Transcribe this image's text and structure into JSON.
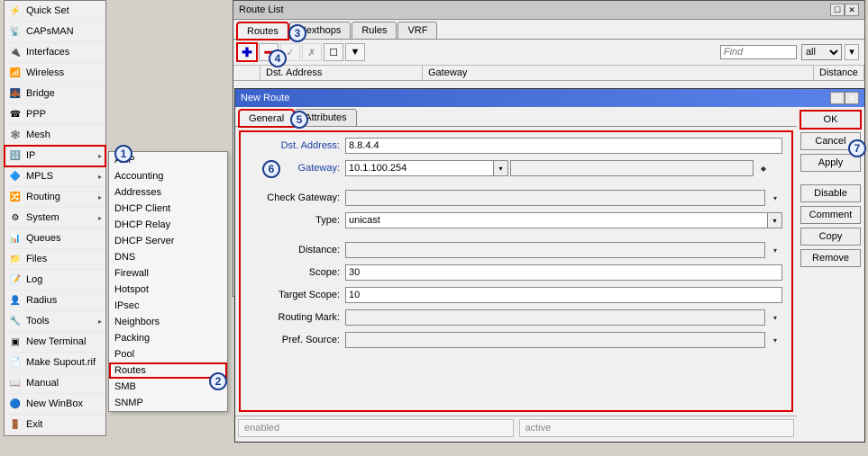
{
  "sidebar": {
    "items": [
      {
        "label": "Quick Set",
        "icon": "⚙"
      },
      {
        "label": "CAPsMAN",
        "icon": "📡"
      },
      {
        "label": "Interfaces",
        "icon": "🔌"
      },
      {
        "label": "Wireless",
        "icon": "📶"
      },
      {
        "label": "Bridge",
        "icon": "🌉"
      },
      {
        "label": "PPP",
        "icon": "☎"
      },
      {
        "label": "Mesh",
        "icon": "🕸"
      },
      {
        "label": "IP",
        "icon": "🔢",
        "arrow": true,
        "highlighted": true
      },
      {
        "label": "MPLS",
        "icon": "🔷",
        "arrow": true
      },
      {
        "label": "Routing",
        "icon": "🔀",
        "arrow": true
      },
      {
        "label": "System",
        "icon": "⚙",
        "arrow": true
      },
      {
        "label": "Queues",
        "icon": "📊"
      },
      {
        "label": "Files",
        "icon": "📁"
      },
      {
        "label": "Log",
        "icon": "📝"
      },
      {
        "label": "Radius",
        "icon": "👤"
      },
      {
        "label": "Tools",
        "icon": "🔧",
        "arrow": true
      },
      {
        "label": "New Terminal",
        "icon": "▣"
      },
      {
        "label": "Make Supout.rif",
        "icon": "📄"
      },
      {
        "label": "Manual",
        "icon": "📖"
      },
      {
        "label": "New WinBox",
        "icon": "🔵"
      },
      {
        "label": "Exit",
        "icon": "🚪"
      }
    ]
  },
  "submenu": {
    "items": [
      "ARP",
      "Accounting",
      "Addresses",
      "DHCP Client",
      "DHCP Relay",
      "DHCP Server",
      "DNS",
      "Firewall",
      "Hotspot",
      "IPsec",
      "Neighbors",
      "Packing",
      "Pool",
      "Routes",
      "SMB",
      "SNMP"
    ],
    "highlighted": "Routes"
  },
  "routelist": {
    "title": "Route List",
    "tabs": [
      "Routes",
      "Nexthops",
      "Rules",
      "VRF"
    ],
    "active_tab": "Routes",
    "find_placeholder": "Find",
    "filter_all": "all",
    "columns": {
      "dst": "Dst. Address",
      "gw": "Gateway",
      "dist": "Distance"
    }
  },
  "newroute": {
    "title": "New Route",
    "tabs": [
      "General",
      "Attributes"
    ],
    "active_tab": "General",
    "fields": {
      "dst_address": {
        "label": "Dst. Address:",
        "value": "8.8.4.4"
      },
      "gateway": {
        "label": "Gateway:",
        "value": "10.1.100.254"
      },
      "check_gateway": {
        "label": "Check Gateway:",
        "value": ""
      },
      "type": {
        "label": "Type:",
        "value": "unicast"
      },
      "distance": {
        "label": "Distance:",
        "value": ""
      },
      "scope": {
        "label": "Scope:",
        "value": "30"
      },
      "target_scope": {
        "label": "Target Scope:",
        "value": "10"
      },
      "routing_mark": {
        "label": "Routing Mark:",
        "value": ""
      },
      "pref_source": {
        "label": "Pref. Source:",
        "value": ""
      }
    },
    "buttons": [
      "OK",
      "Cancel",
      "Apply",
      "Disable",
      "Comment",
      "Copy",
      "Remove"
    ],
    "status": {
      "enabled": "enabled",
      "active": "active"
    }
  },
  "steps": {
    "1": "1",
    "2": "2",
    "3": "3",
    "4": "4",
    "5": "5",
    "6": "6",
    "7": "7"
  }
}
